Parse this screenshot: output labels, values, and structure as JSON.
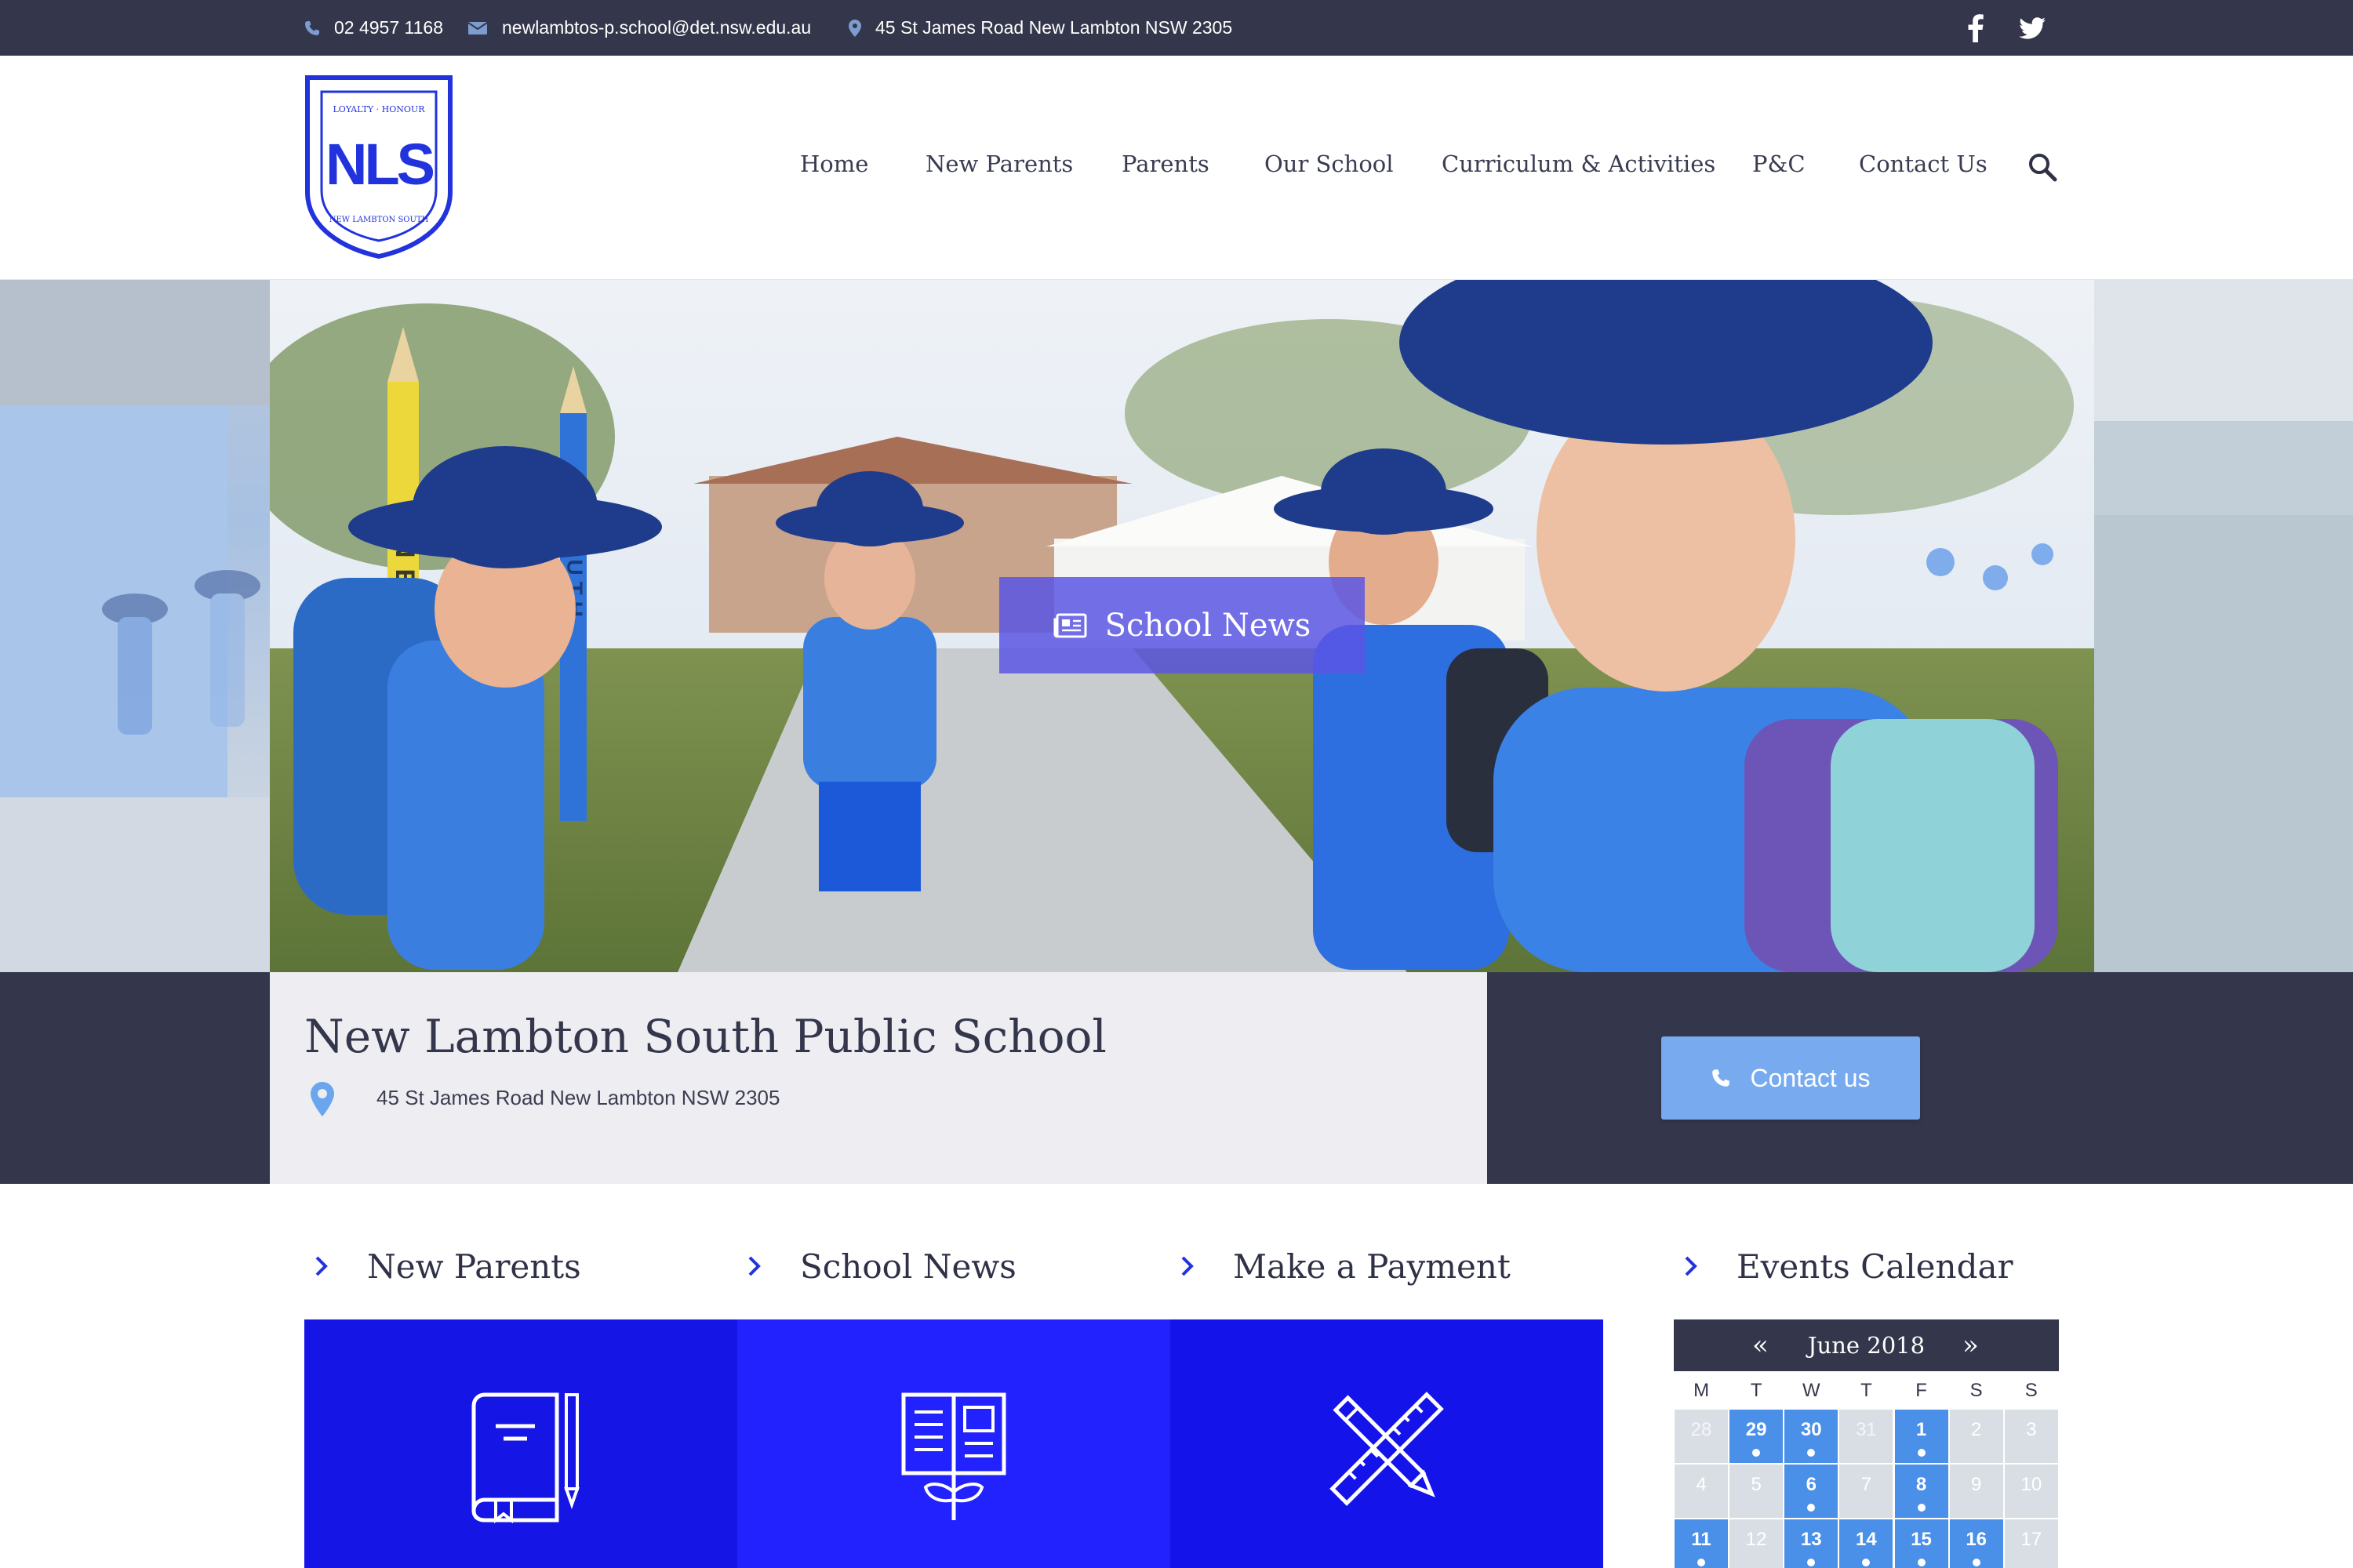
{
  "topbar": {
    "phone": "02 4957 1168",
    "email": "newlambtos-p.school@det.nsw.edu.au",
    "address": "45 St James Road New Lambton NSW 2305",
    "social": [
      "facebook-icon",
      "twitter-icon"
    ]
  },
  "logo": {
    "letters": "NLS",
    "motto_top": "LOYALTY · HONOUR",
    "motto_bottom": "NEW LAMBTON SOUTH"
  },
  "nav": {
    "items": [
      "Home",
      "New Parents",
      "Parents",
      "Our School",
      "Curriculum & Activities",
      "P&C",
      "Contact Us"
    ]
  },
  "hero": {
    "button_label": "School News",
    "pole_text_1": "NEW",
    "pole_text_2": "SOUTH"
  },
  "info": {
    "school_name": "New Lambton South Public School",
    "address": "45 St James Road New Lambton NSW 2305",
    "contact_label": "Contact us"
  },
  "sections": {
    "new_parents": "New Parents",
    "school_news": "School News",
    "make_payment": "Make a Payment",
    "events_calendar": "Events Calendar"
  },
  "colors": {
    "dark": "#34374b",
    "tile_1": "#1515e6",
    "tile_2": "#2222ff",
    "tile_3": "#1414ea",
    "event_blue": "#4a90e8",
    "contact_blue": "#78aaf0"
  },
  "calendar": {
    "prev": "«",
    "next": "»",
    "month": "June 2018",
    "dows": [
      "M",
      "T",
      "W",
      "T",
      "F",
      "S",
      "S"
    ],
    "weeks": [
      [
        {
          "d": "28",
          "m": "prev"
        },
        {
          "d": "29",
          "m": "prev",
          "ev": true
        },
        {
          "d": "30",
          "m": "prev",
          "ev": true
        },
        {
          "d": "31",
          "m": "prev"
        },
        {
          "d": "1",
          "m": "cur",
          "ev": true
        },
        {
          "d": "2",
          "m": "cur"
        },
        {
          "d": "3",
          "m": "cur"
        }
      ],
      [
        {
          "d": "4",
          "m": "cur"
        },
        {
          "d": "5",
          "m": "cur"
        },
        {
          "d": "6",
          "m": "cur",
          "ev": true
        },
        {
          "d": "7",
          "m": "cur"
        },
        {
          "d": "8",
          "m": "cur",
          "ev": true
        },
        {
          "d": "9",
          "m": "cur"
        },
        {
          "d": "10",
          "m": "cur"
        }
      ],
      [
        {
          "d": "11",
          "m": "cur",
          "ev": true
        },
        {
          "d": "12",
          "m": "cur"
        },
        {
          "d": "13",
          "m": "cur",
          "ev": true
        },
        {
          "d": "14",
          "m": "cur",
          "ev": true
        },
        {
          "d": "15",
          "m": "cur",
          "ev": true
        },
        {
          "d": "16",
          "m": "cur",
          "ev": true
        },
        {
          "d": "17",
          "m": "cur"
        }
      ]
    ]
  }
}
